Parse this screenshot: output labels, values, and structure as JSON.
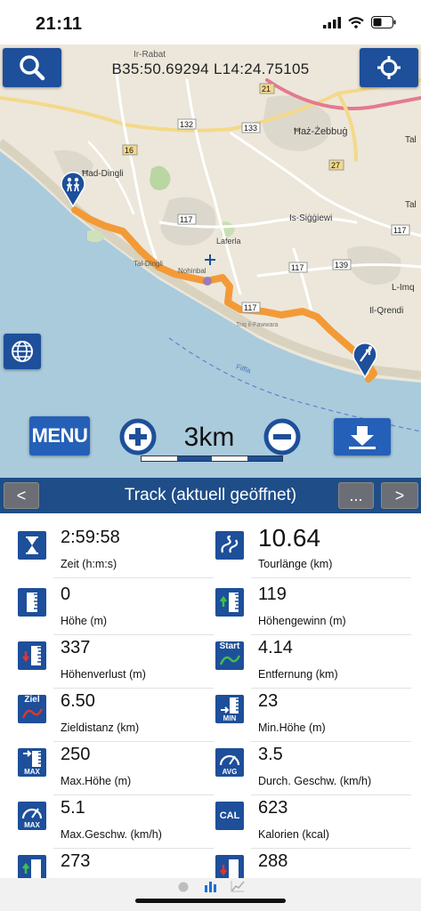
{
  "status": {
    "time": "21:11"
  },
  "map": {
    "coords": "B35:50.69294 L14:24.75105",
    "place_labels": {
      "dingli": "Ħad-Dingli",
      "rabat": "Ir-Rabat",
      "zebbug": "Ħaż-Żebbuġ",
      "siggiewi": "Is-Siġġiewi",
      "laferla": "Laferla",
      "qrendi": "Il-Qrendi",
      "tal": "Tal",
      "tal2": "Tal",
      "imqabba": "L-Imq",
      "fawwara": "Triq il-Fawwara",
      "filfla": "Filfla",
      "nohinbal": "Nohinbal",
      "dingli_cliffs": "Tal-Dingli"
    },
    "road_numbers": [
      "132",
      "133",
      "16",
      "21",
      "27",
      "117",
      "117",
      "117",
      "117",
      "139"
    ],
    "zoom_label": "3km",
    "menu_label": "MENU"
  },
  "header": {
    "title": "Track (aktuell geöffnet)",
    "prev": "<",
    "more": "...",
    "next": ">"
  },
  "stats": [
    {
      "value": "2:59:58",
      "label": "Zeit (h:m:s)",
      "icon": "hourglass-icon"
    },
    {
      "value": "10.64",
      "label": "Tourlänge (km)",
      "icon": "track-length-icon"
    },
    {
      "value": "0",
      "label": "Höhe (m)",
      "icon": "altitude-icon"
    },
    {
      "value": "119",
      "label": "Höhengewinn (m)",
      "icon": "elevation-gain-icon"
    },
    {
      "value": "337",
      "label": "Höhenverlust (m)",
      "icon": "elevation-loss-icon"
    },
    {
      "value": "4.14",
      "label": "Entfernung (km)",
      "icon": "start-distance-icon"
    },
    {
      "value": "6.50",
      "label": "Zieldistanz (km)",
      "icon": "goal-distance-icon"
    },
    {
      "value": "23",
      "label": "Min.Höhe (m)",
      "icon": "min-altitude-icon"
    },
    {
      "value": "250",
      "label": "Max.Höhe (m)",
      "icon": "max-altitude-icon"
    },
    {
      "value": "3.5",
      "label": "Durch. Geschw. (km/h)",
      "icon": "avg-speed-icon"
    },
    {
      "value": "5.1",
      "label": "Max.Geschw. (km/h)",
      "icon": "max-speed-icon"
    },
    {
      "value": "623",
      "label": "Kalorien (kcal)",
      "icon": "calories-icon"
    },
    {
      "value": "273",
      "label": "",
      "icon": "elevation-gain-icon"
    },
    {
      "value": "288",
      "label": "",
      "icon": "elevation-loss-icon"
    }
  ],
  "icon_text": {
    "start": "Start",
    "ziel": "Ziel",
    "min": "MIN",
    "max": "MAX",
    "avg": "AVG",
    "cal": "CAL"
  },
  "colors": {
    "accent": "#1d4f9a",
    "header": "#1e4d88",
    "track": "#f39a37",
    "sea": "#a9c9d9"
  }
}
